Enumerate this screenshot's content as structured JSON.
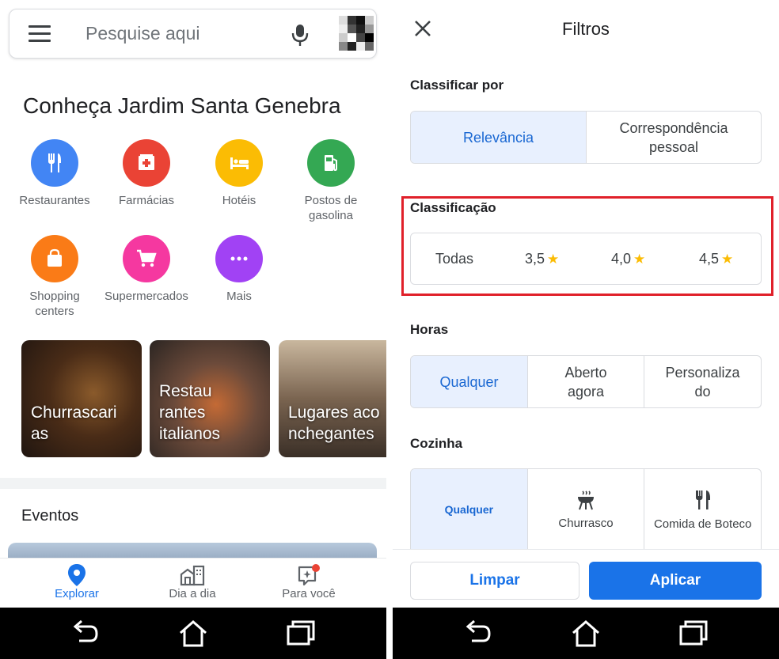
{
  "left": {
    "search": {
      "placeholder": "Pesquise aqui"
    },
    "title": "Conheça Jardim Santa Genebra",
    "categories": [
      {
        "label": "Restaurantes",
        "icon": "fork-knife-icon",
        "color": "#4285f4"
      },
      {
        "label": "Farmácias",
        "icon": "pharmacy-icon",
        "color": "#ea4335"
      },
      {
        "label": "Hotéis",
        "icon": "bed-icon",
        "color": "#fbbc04"
      },
      {
        "label": "Postos de\ngasolina",
        "icon": "gas-station-icon",
        "color": "#34a853"
      },
      {
        "label": "Shopping\ncenters",
        "icon": "shopping-bag-icon",
        "color": "#fa7b17"
      },
      {
        "label": "Supermercados",
        "icon": "cart-icon",
        "color": "#f538a0"
      },
      {
        "label": "Mais",
        "icon": "more-icon",
        "color": "#a142f4"
      }
    ],
    "cards": [
      {
        "label": "Churrascari\nas"
      },
      {
        "label": "Restau\nrantes\nitalianos"
      },
      {
        "label": "Lugares aco\nnchegantes"
      }
    ],
    "events_heading": "Eventos",
    "nav": [
      {
        "label": "Explorar",
        "icon": "location-pin-icon",
        "active": true
      },
      {
        "label": "Dia a dia",
        "icon": "commute-icon",
        "active": false
      },
      {
        "label": "Para você",
        "icon": "for-you-icon",
        "active": false
      }
    ]
  },
  "right": {
    "title": "Filtros",
    "sort": {
      "heading": "Classificar por",
      "options": [
        "Relevância",
        "Correspondência\npessoal"
      ],
      "selected": 0
    },
    "rating": {
      "heading": "Classificação",
      "options": [
        "Todas",
        "3,5",
        "4,0",
        "4,5"
      ]
    },
    "hours": {
      "heading": "Horas",
      "options": [
        "Qualquer",
        "Aberto\nagora",
        "Personaliza\ndo"
      ],
      "selected": 0
    },
    "cuisine": {
      "heading": "Cozinha",
      "options": [
        {
          "label": "Qualquer",
          "icon": ""
        },
        {
          "label": "Churrasco",
          "icon": "grill-icon"
        },
        {
          "label": "Comida de Boteco",
          "icon": "fork-knife-icon"
        }
      ],
      "selected": 0
    },
    "buttons": {
      "clear": "Limpar",
      "apply": "Aplicar"
    }
  },
  "colors": {
    "accent": "#1a73e8",
    "selected_bg": "#e8f0fe",
    "star": "#fbbc04",
    "highlight_box": "#e0202a"
  }
}
